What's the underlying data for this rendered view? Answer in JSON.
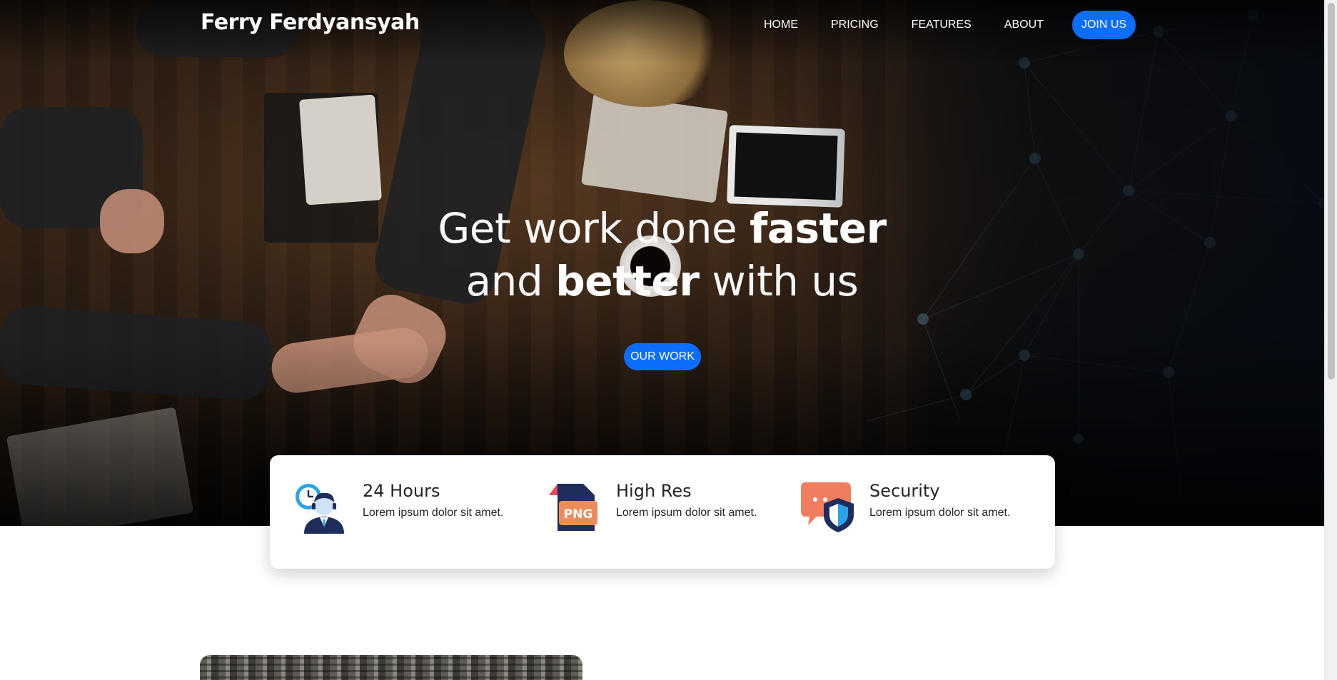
{
  "brand": {
    "name": "Ferry Ferdyansyah"
  },
  "nav": {
    "items": [
      {
        "label": "HOME"
      },
      {
        "label": "PRICING"
      },
      {
        "label": "FEATURES"
      },
      {
        "label": "ABOUT"
      }
    ],
    "cta_label": "JOIN US"
  },
  "hero": {
    "line1_light": "Get work done ",
    "line1_bold": "faster",
    "line2_light_a": "and ",
    "line2_bold": "better",
    "line2_light_b": " with us",
    "button_label": "OUR WORK"
  },
  "features": [
    {
      "icon": "clock-support-agent-icon",
      "title": "24 Hours",
      "text": "Lorem ipsum dolor sit amet."
    },
    {
      "icon": "png-file-icon",
      "title": "High Res",
      "text": "Lorem ipsum dolor sit amet.",
      "badge": "PNG"
    },
    {
      "icon": "chat-shield-icon",
      "title": "Security",
      "text": "Lorem ipsum dolor sit amet."
    }
  ],
  "colors": {
    "accent": "#0d6efd",
    "text_dark": "#212529",
    "icon_navy": "#1e2d5c",
    "icon_orange": "#ef8a5b",
    "icon_blue": "#2aa3e8"
  }
}
